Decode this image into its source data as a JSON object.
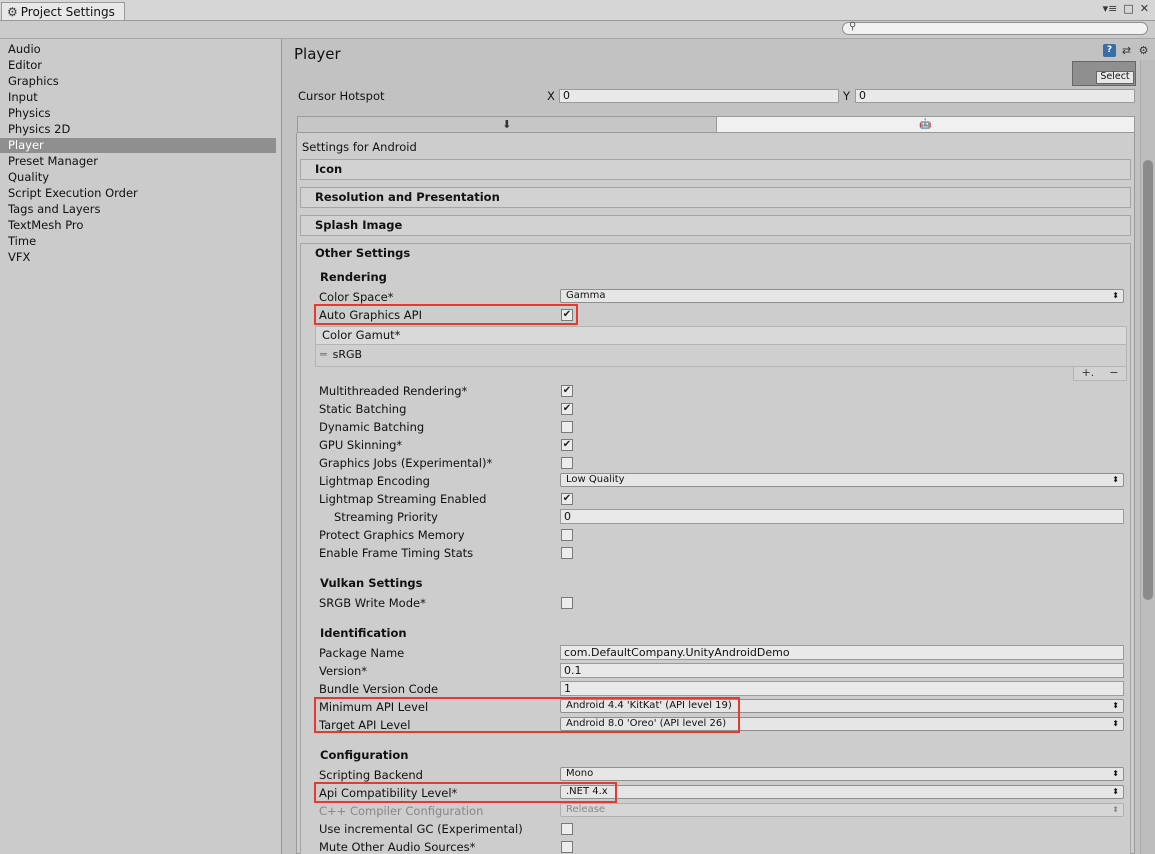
{
  "window": {
    "tab_label": "Project Settings",
    "controls": [
      "▾≡",
      "□",
      "✕"
    ]
  },
  "search": {
    "placeholder": ""
  },
  "sidebar": {
    "items": [
      {
        "label": "Audio"
      },
      {
        "label": "Editor"
      },
      {
        "label": "Graphics"
      },
      {
        "label": "Input"
      },
      {
        "label": "Physics"
      },
      {
        "label": "Physics 2D"
      },
      {
        "label": "Player",
        "selected": true
      },
      {
        "label": "Preset Manager"
      },
      {
        "label": "Quality"
      },
      {
        "label": "Script Execution Order"
      },
      {
        "label": "Tags and Layers"
      },
      {
        "label": "TextMesh Pro"
      },
      {
        "label": "Time"
      },
      {
        "label": "VFX"
      }
    ]
  },
  "main": {
    "title": "Player",
    "select_button": "Select",
    "cursor_hotspot": {
      "label": "Cursor Hotspot",
      "x_label": "X",
      "x_value": "0",
      "y_label": "Y",
      "y_value": "0"
    },
    "platform_tabs": [
      {
        "icon": "standalone-download-icon",
        "glyph": "⬇"
      },
      {
        "icon": "android-icon",
        "glyph": "🤖"
      }
    ],
    "settings_for": "Settings for Android",
    "foldouts": [
      "Icon",
      "Resolution and Presentation",
      "Splash Image",
      "Other Settings"
    ],
    "rendering": {
      "heading": "Rendering",
      "color_space_label": "Color Space*",
      "color_space_value": "Gamma",
      "auto_graphics_api_label": "Auto Graphics API",
      "auto_graphics_api": true,
      "color_gamut_label": "Color Gamut*",
      "color_gamut_items": [
        "sRGB"
      ],
      "add_symbol": "+.",
      "remove_symbol": "−",
      "multithreaded_label": "Multithreaded Rendering*",
      "multithreaded": true,
      "static_batching_label": "Static Batching",
      "static_batching": true,
      "dynamic_batching_label": "Dynamic Batching",
      "dynamic_batching": false,
      "gpu_skinning_label": "GPU Skinning*",
      "gpu_skinning": true,
      "graphics_jobs_label": "Graphics Jobs (Experimental)*",
      "graphics_jobs": false,
      "lightmap_encoding_label": "Lightmap Encoding",
      "lightmap_encoding_value": "Low Quality",
      "lightmap_streaming_label": "Lightmap Streaming Enabled",
      "lightmap_streaming": true,
      "streaming_priority_label": "Streaming Priority",
      "streaming_priority_value": "0",
      "protect_memory_label": "Protect Graphics Memory",
      "protect_memory": false,
      "frame_timing_label": "Enable Frame Timing Stats",
      "frame_timing": false
    },
    "vulkan": {
      "heading": "Vulkan Settings",
      "srgb_write_label": "SRGB Write Mode*",
      "srgb_write": false
    },
    "identification": {
      "heading": "Identification",
      "package_name_label": "Package Name",
      "package_name": "com.DefaultCompany.UnityAndroidDemo",
      "version_label": "Version*",
      "version": "0.1",
      "bundle_code_label": "Bundle Version Code",
      "bundle_code": "1",
      "min_api_label": "Minimum API Level",
      "min_api": "Android 4.4 'KitKat' (API level 19)",
      "target_api_label": "Target API Level",
      "target_api": "Android 8.0 'Oreo' (API level 26)"
    },
    "configuration": {
      "heading": "Configuration",
      "scripting_backend_label": "Scripting Backend",
      "scripting_backend": "Mono",
      "api_compat_label": "Api Compatibility Level*",
      "api_compat": ".NET 4.x",
      "cpp_config_label": "C++ Compiler Configuration",
      "cpp_config": "Release",
      "incremental_gc_label": "Use incremental GC (Experimental)",
      "incremental_gc": false,
      "mute_audio_label": "Mute Other Audio Sources*",
      "mute_audio": false
    }
  },
  "colors": {
    "highlight": "#e53a2f",
    "selected_nav": "#8f8f8f",
    "help_icon": "#3b6ea5"
  }
}
